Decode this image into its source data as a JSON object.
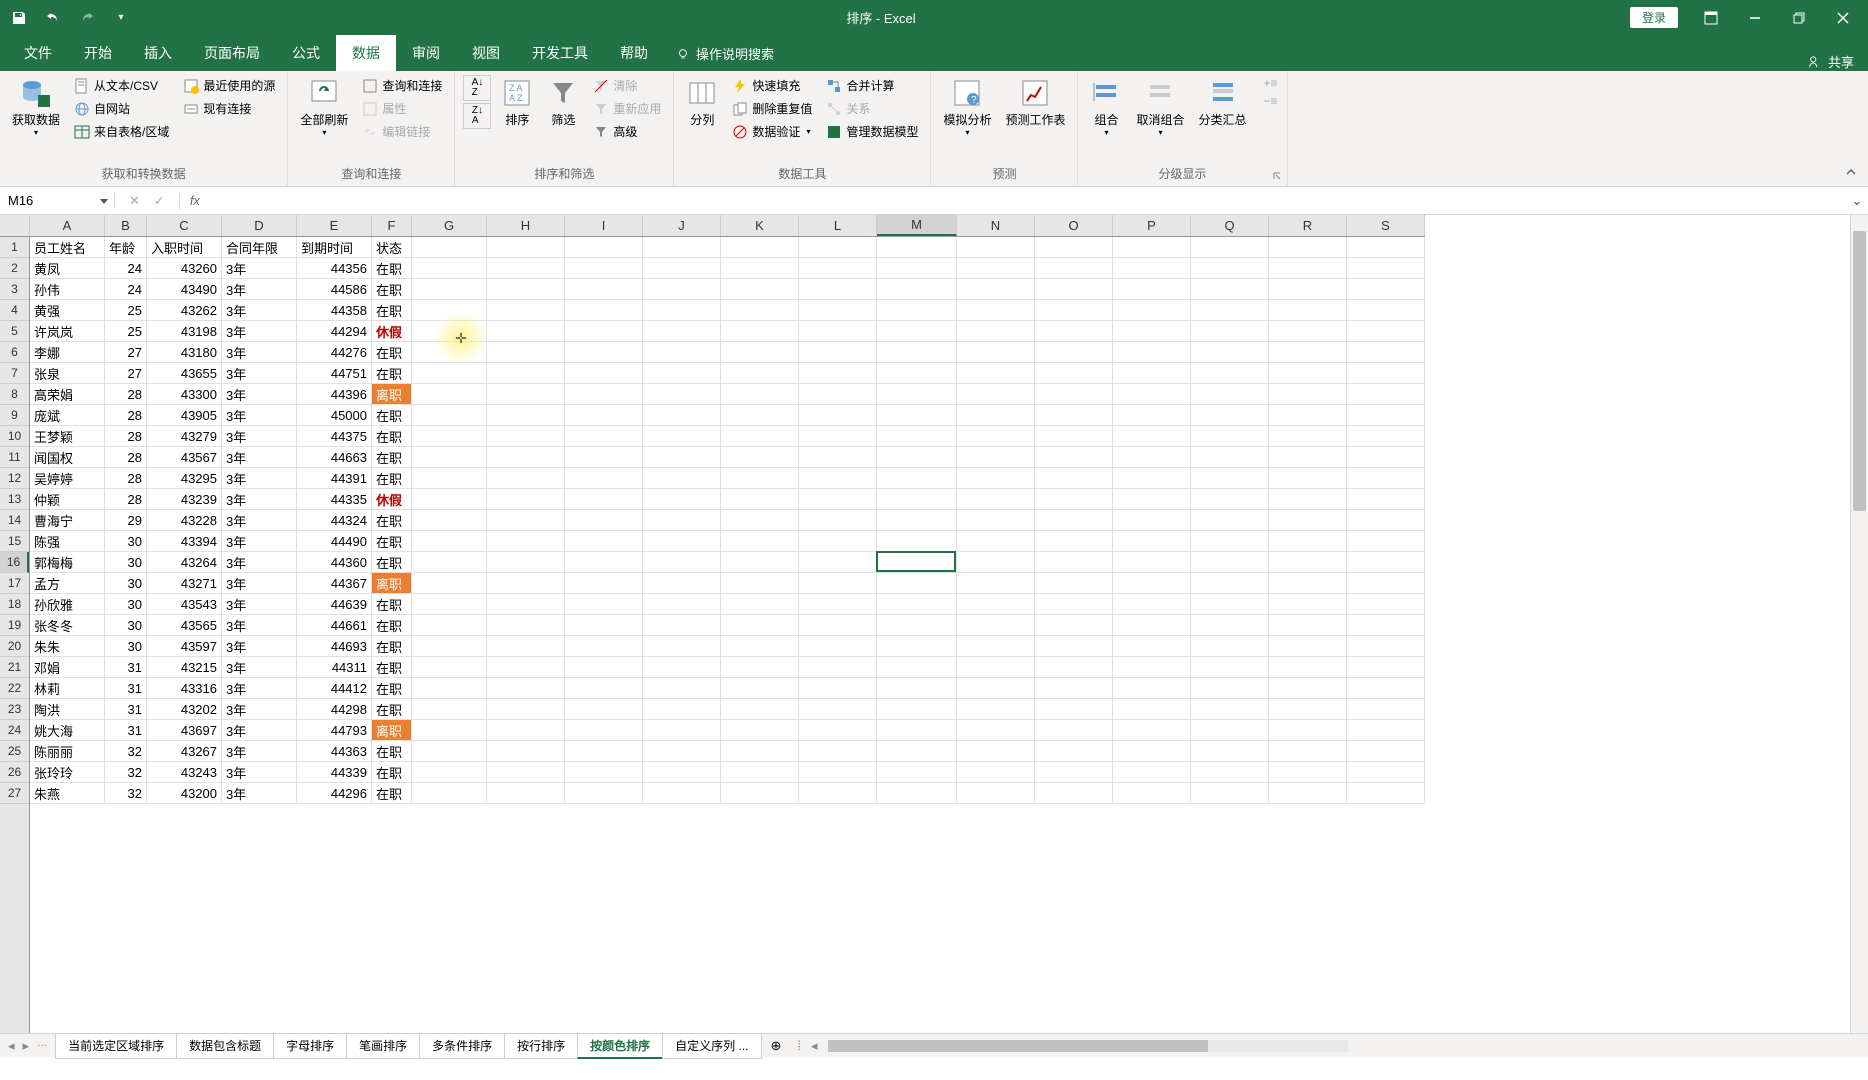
{
  "titlebar": {
    "title": "排序 - Excel",
    "login": "登录"
  },
  "tabs": {
    "file": "文件",
    "home": "开始",
    "insert": "插入",
    "layout": "页面布局",
    "formulas": "公式",
    "data": "数据",
    "review": "审阅",
    "view": "视图",
    "dev": "开发工具",
    "help": "帮助",
    "tellme": "操作说明搜索",
    "share": "共享"
  },
  "ribbon": {
    "getdata": {
      "main": "获取数据",
      "fromtext": "从文本/CSV",
      "fromweb": "自网站",
      "fromtable": "来自表格/区域",
      "recent": "最近使用的源",
      "existing": "现有连接",
      "group": "获取和转换数据"
    },
    "queries": {
      "refresh": "全部刷新",
      "qc": "查询和连接",
      "props": "属性",
      "editlinks": "编辑链接",
      "group": "查询和连接"
    },
    "sort": {
      "az": "A→Z",
      "za": "Z→A",
      "sort": "排序",
      "filter": "筛选",
      "clear": "清除",
      "reapply": "重新应用",
      "adv": "高级",
      "group": "排序和筛选"
    },
    "datatools": {
      "t2c": "分列",
      "flash": "快速填充",
      "dup": "删除重复值",
      "valid": "数据验证",
      "consol": "合并计算",
      "rel": "关系",
      "model": "管理数据模型",
      "group": "数据工具"
    },
    "forecast": {
      "whatif": "模拟分析",
      "sheet": "预测工作表",
      "group": "预测"
    },
    "outline": {
      "group_btn": "组合",
      "ungroup": "取消组合",
      "subtotal": "分类汇总",
      "group": "分级显示"
    }
  },
  "namebox": "M16",
  "columns": [
    "A",
    "B",
    "C",
    "D",
    "E",
    "F",
    "G",
    "H",
    "I",
    "J",
    "K",
    "L",
    "M",
    "N",
    "O",
    "P",
    "Q",
    "R",
    "S"
  ],
  "headers": [
    "员工姓名",
    "年龄",
    "入职时间",
    "合同年限",
    "到期时间",
    "状态"
  ],
  "rows": [
    {
      "n": 2,
      "a": "黄凤",
      "b": 24,
      "c": 43260,
      "d": "3年",
      "e": 44356,
      "f": "在职",
      "fs": "normal"
    },
    {
      "n": 3,
      "a": "孙伟",
      "b": 24,
      "c": 43490,
      "d": "3年",
      "e": 44586,
      "f": "在职",
      "fs": "normal"
    },
    {
      "n": 4,
      "a": "黄强",
      "b": 25,
      "c": 43262,
      "d": "3年",
      "e": 44358,
      "f": "在职",
      "fs": "normal"
    },
    {
      "n": 5,
      "a": "许岚岚",
      "b": 25,
      "c": 43198,
      "d": "3年",
      "e": 44294,
      "f": "休假",
      "fs": "red"
    },
    {
      "n": 6,
      "a": "李娜",
      "b": 27,
      "c": 43180,
      "d": "3年",
      "e": 44276,
      "f": "在职",
      "fs": "normal"
    },
    {
      "n": 7,
      "a": "张泉",
      "b": 27,
      "c": 43655,
      "d": "3年",
      "e": 44751,
      "f": "在职",
      "fs": "normal"
    },
    {
      "n": 8,
      "a": "高荣娟",
      "b": 28,
      "c": 43300,
      "d": "3年",
      "e": 44396,
      "f": "离职",
      "fs": "orange"
    },
    {
      "n": 9,
      "a": "庞斌",
      "b": 28,
      "c": 43905,
      "d": "3年",
      "e": 45000,
      "f": "在职",
      "fs": "normal"
    },
    {
      "n": 10,
      "a": "王梦颖",
      "b": 28,
      "c": 43279,
      "d": "3年",
      "e": 44375,
      "f": "在职",
      "fs": "normal"
    },
    {
      "n": 11,
      "a": "闻国权",
      "b": 28,
      "c": 43567,
      "d": "3年",
      "e": 44663,
      "f": "在职",
      "fs": "normal"
    },
    {
      "n": 12,
      "a": "吴婷婷",
      "b": 28,
      "c": 43295,
      "d": "3年",
      "e": 44391,
      "f": "在职",
      "fs": "normal"
    },
    {
      "n": 13,
      "a": "仲颖",
      "b": 28,
      "c": 43239,
      "d": "3年",
      "e": 44335,
      "f": "休假",
      "fs": "red"
    },
    {
      "n": 14,
      "a": "曹海宁",
      "b": 29,
      "c": 43228,
      "d": "3年",
      "e": 44324,
      "f": "在职",
      "fs": "normal"
    },
    {
      "n": 15,
      "a": "陈强",
      "b": 30,
      "c": 43394,
      "d": "3年",
      "e": 44490,
      "f": "在职",
      "fs": "normal"
    },
    {
      "n": 16,
      "a": "郭梅梅",
      "b": 30,
      "c": 43264,
      "d": "3年",
      "e": 44360,
      "f": "在职",
      "fs": "normal"
    },
    {
      "n": 17,
      "a": "孟方",
      "b": 30,
      "c": 43271,
      "d": "3年",
      "e": 44367,
      "f": "离职",
      "fs": "orange"
    },
    {
      "n": 18,
      "a": "孙欣雅",
      "b": 30,
      "c": 43543,
      "d": "3年",
      "e": 44639,
      "f": "在职",
      "fs": "normal"
    },
    {
      "n": 19,
      "a": "张冬冬",
      "b": 30,
      "c": 43565,
      "d": "3年",
      "e": 44661,
      "f": "在职",
      "fs": "normal"
    },
    {
      "n": 20,
      "a": "朱朱",
      "b": 30,
      "c": 43597,
      "d": "3年",
      "e": 44693,
      "f": "在职",
      "fs": "normal"
    },
    {
      "n": 21,
      "a": "邓娟",
      "b": 31,
      "c": 43215,
      "d": "3年",
      "e": 44311,
      "f": "在职",
      "fs": "normal"
    },
    {
      "n": 22,
      "a": "林莉",
      "b": 31,
      "c": 43316,
      "d": "3年",
      "e": 44412,
      "f": "在职",
      "fs": "normal"
    },
    {
      "n": 23,
      "a": "陶洪",
      "b": 31,
      "c": 43202,
      "d": "3年",
      "e": 44298,
      "f": "在职",
      "fs": "normal"
    },
    {
      "n": 24,
      "a": "姚大海",
      "b": 31,
      "c": 43697,
      "d": "3年",
      "e": 44793,
      "f": "离职",
      "fs": "orange"
    },
    {
      "n": 25,
      "a": "陈丽丽",
      "b": 32,
      "c": 43267,
      "d": "3年",
      "e": 44363,
      "f": "在职",
      "fs": "normal"
    },
    {
      "n": 26,
      "a": "张玲玲",
      "b": 32,
      "c": 43243,
      "d": "3年",
      "e": 44339,
      "f": "在职",
      "fs": "normal"
    },
    {
      "n": 27,
      "a": "朱燕",
      "b": 32,
      "c": 43200,
      "d": "3年",
      "e": 44296,
      "f": "在职",
      "fs": "normal"
    }
  ],
  "sheets": [
    "当前选定区域排序",
    "数据包含标题",
    "字母排序",
    "笔画排序",
    "多条件排序",
    "按行排序",
    "按颜色排序",
    "自定义序列 ..."
  ],
  "active_sheet": 6,
  "active_cell": {
    "col": "M",
    "row": 16
  }
}
